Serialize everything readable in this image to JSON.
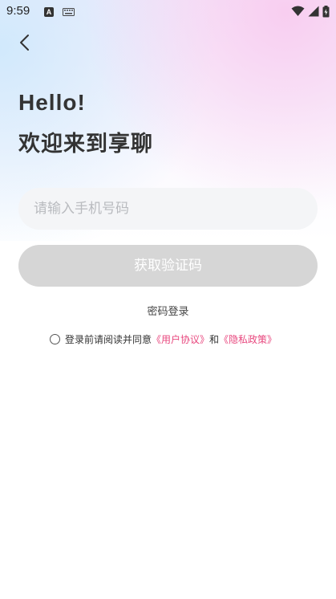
{
  "status_bar": {
    "time": "9:59",
    "app_icon_letter": "A"
  },
  "header": {
    "hello": "Hello!",
    "welcome": "欢迎来到享聊"
  },
  "form": {
    "phone_placeholder": "请输入手机号码",
    "phone_value": "",
    "get_code_label": "获取验证码",
    "password_login_label": "密码登录"
  },
  "agreement": {
    "prefix": "登录前请阅读并同意",
    "user_agreement": "《用户协议》",
    "and": "和",
    "privacy_policy": "《隐私政策》"
  },
  "colors": {
    "accent_link": "#e8477e",
    "button_disabled": "#d6d6d6",
    "input_bg": "#f4f5f7"
  },
  "icons": {
    "back": "chevron-left-icon",
    "wifi": "wifi-icon",
    "signal": "signal-icon",
    "battery": "battery-icon"
  }
}
